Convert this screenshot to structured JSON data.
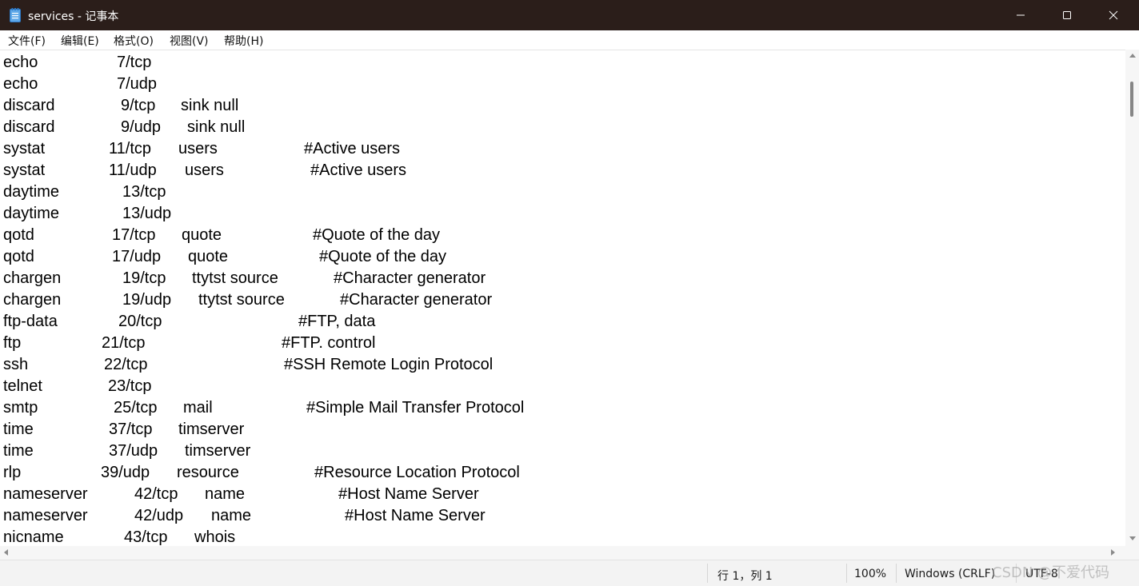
{
  "window": {
    "title": "services - 记事本",
    "app_icon": "notepad-icon",
    "controls": [
      "minimize-icon",
      "maximize-icon",
      "close-icon"
    ]
  },
  "menu": {
    "items": [
      "文件(F)",
      "编辑(E)",
      "格式(O)",
      "视图(V)",
      "帮助(H)"
    ]
  },
  "editor": {
    "lines": [
      {
        "name": "echo",
        "port": "7/tcp",
        "aliases": "",
        "comment": ""
      },
      {
        "name": "echo",
        "port": "7/udp",
        "aliases": "",
        "comment": ""
      },
      {
        "name": "discard",
        "port": "9/tcp",
        "aliases": "sink null",
        "comment": ""
      },
      {
        "name": "discard",
        "port": "9/udp",
        "aliases": "sink null",
        "comment": ""
      },
      {
        "name": "systat",
        "port": "11/tcp",
        "aliases": "users",
        "comment": "#Active users"
      },
      {
        "name": "systat",
        "port": "11/udp",
        "aliases": "users",
        "comment": "#Active users"
      },
      {
        "name": "daytime",
        "port": "13/tcp",
        "aliases": "",
        "comment": ""
      },
      {
        "name": "daytime",
        "port": "13/udp",
        "aliases": "",
        "comment": ""
      },
      {
        "name": "qotd",
        "port": "17/tcp",
        "aliases": "quote",
        "comment": "#Quote of the day"
      },
      {
        "name": "qotd",
        "port": "17/udp",
        "aliases": "quote",
        "comment": "#Quote of the day"
      },
      {
        "name": "chargen",
        "port": "19/tcp",
        "aliases": "ttytst source",
        "comment": "#Character generator"
      },
      {
        "name": "chargen",
        "port": "19/udp",
        "aliases": "ttytst source",
        "comment": "#Character generator"
      },
      {
        "name": "ftp-data",
        "port": "20/tcp",
        "aliases": "",
        "comment": "#FTP, data"
      },
      {
        "name": "ftp",
        "port": "21/tcp",
        "aliases": "",
        "comment": "#FTP. control"
      },
      {
        "name": "ssh",
        "port": "22/tcp",
        "aliases": "",
        "comment": "#SSH Remote Login Protocol"
      },
      {
        "name": "telnet",
        "port": "23/tcp",
        "aliases": "",
        "comment": ""
      },
      {
        "name": "smtp",
        "port": "25/tcp",
        "aliases": "mail",
        "comment": "#Simple Mail Transfer Protocol"
      },
      {
        "name": "time",
        "port": "37/tcp",
        "aliases": "timserver",
        "comment": ""
      },
      {
        "name": "time",
        "port": "37/udp",
        "aliases": "timserver",
        "comment": ""
      },
      {
        "name": "rlp",
        "port": "39/udp",
        "aliases": "resource",
        "comment": "#Resource Location Protocol"
      },
      {
        "name": "nameserver",
        "port": "42/tcp",
        "aliases": "name",
        "comment": "#Host Name Server"
      },
      {
        "name": "nameserver",
        "port": "42/udp",
        "aliases": "name",
        "comment": "#Host Name Server"
      },
      {
        "name": "nicname",
        "port": "43/tcp",
        "aliases": "whois",
        "comment": ""
      }
    ]
  },
  "status": {
    "position": "行 1，列 1",
    "zoom": "100%",
    "line_ending": "Windows (CRLF)",
    "encoding": "UTF-8"
  },
  "watermark": "CSDN @不爱代码"
}
